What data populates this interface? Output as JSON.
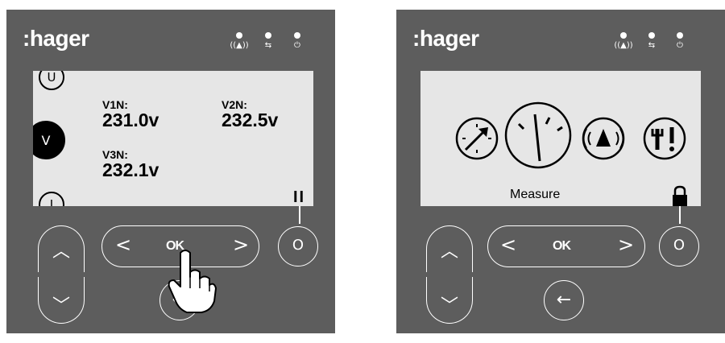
{
  "brand": {
    "logo_text": ":hager"
  },
  "leds": [
    {
      "name": "alarm-led",
      "icon": "((▲))"
    },
    {
      "name": "comm-led",
      "icon": "⇆"
    },
    {
      "name": "power-led",
      "icon": "⏻"
    }
  ],
  "left_screen": {
    "menu": {
      "top": "U",
      "active": "V",
      "bottom": "I"
    },
    "readings": [
      {
        "label": "V1N:",
        "value": "231.0v"
      },
      {
        "label": "V2N:",
        "value": "232.5v"
      },
      {
        "label": "V3N:",
        "value": "232.1v"
      }
    ],
    "pause_label": "II"
  },
  "right_screen": {
    "menu_icons": [
      "gauge-icon",
      "measure-icon",
      "alarm-icon",
      "tools-icon"
    ],
    "selected_label": "Measure"
  },
  "controls": {
    "ok_label": "OK",
    "up_glyph": "︿",
    "down_glyph": "﹀",
    "left_glyph": "<",
    "right_glyph": ">",
    "function_glyph": "O",
    "back_glyph": "←"
  },
  "colors": {
    "panel": "#5d5d5d",
    "lcd": "#e6e6e6",
    "text": "#000000",
    "accent": "#ffffff"
  }
}
